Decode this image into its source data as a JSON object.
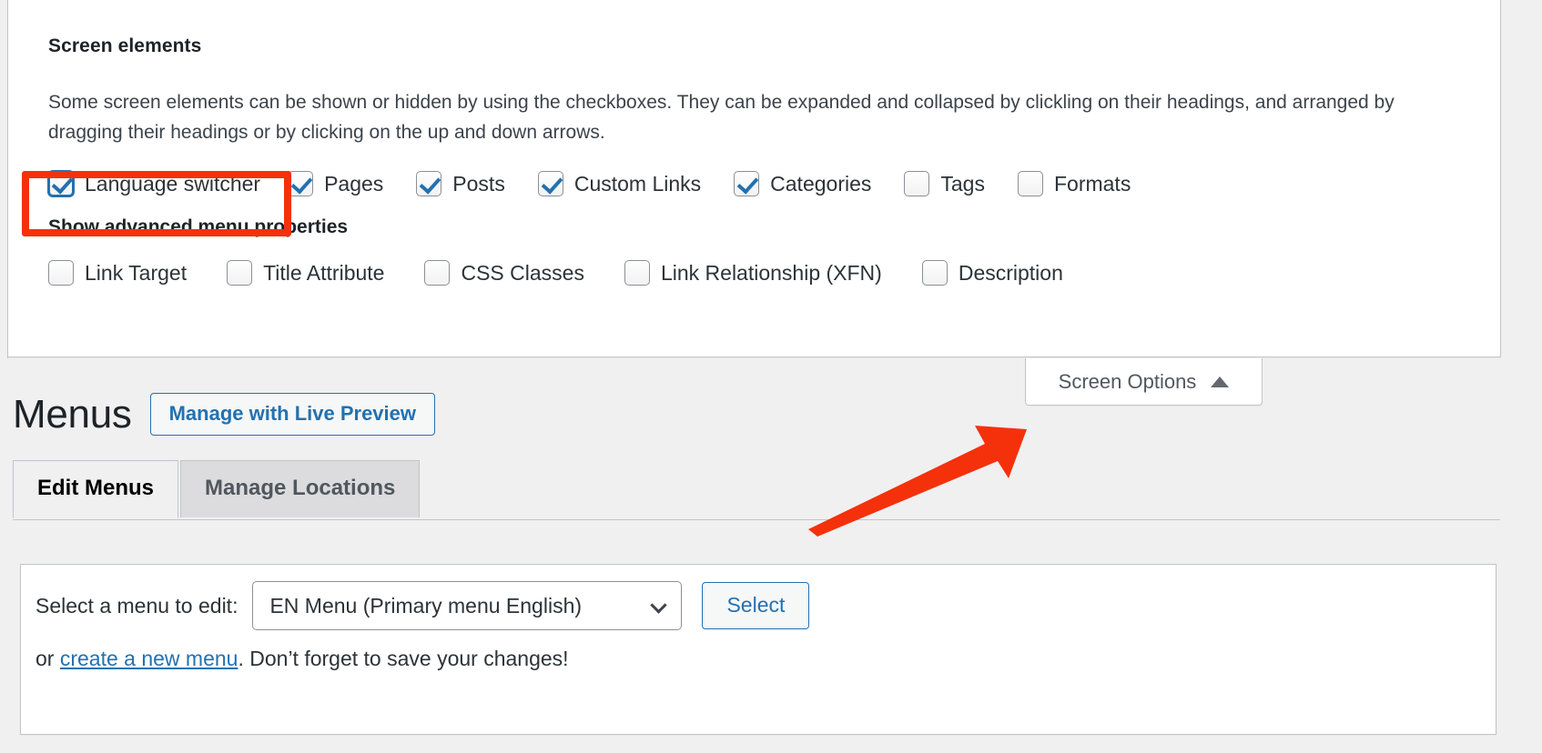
{
  "screen_options_panel": {
    "heading": "Screen elements",
    "description": "Some screen elements can be shown or hidden by using the checkboxes. They can be expanded and collapsed by clickling on their headings, and arranged by dragging their headings or by clicking on the up and down arrows.",
    "elements": [
      {
        "label": "Language switcher",
        "checked": true,
        "focused": true,
        "highlighted": true
      },
      {
        "label": "Pages",
        "checked": true,
        "focused": false,
        "highlighted": false
      },
      {
        "label": "Posts",
        "checked": true,
        "focused": false,
        "highlighted": false
      },
      {
        "label": "Custom Links",
        "checked": true,
        "focused": false,
        "highlighted": false
      },
      {
        "label": "Categories",
        "checked": true,
        "focused": false,
        "highlighted": false
      },
      {
        "label": "Tags",
        "checked": false,
        "focused": false,
        "highlighted": false
      },
      {
        "label": "Formats",
        "checked": false,
        "focused": false,
        "highlighted": false
      }
    ],
    "advanced_heading": "Show advanced menu properties",
    "advanced_properties": [
      {
        "label": "Link Target",
        "checked": false
      },
      {
        "label": "Title Attribute",
        "checked": false
      },
      {
        "label": "CSS Classes",
        "checked": false
      },
      {
        "label": "Link Relationship (XFN)",
        "checked": false
      },
      {
        "label": "Description",
        "checked": false
      }
    ]
  },
  "screen_options_tab": {
    "label": "Screen Options",
    "caret_icon": "triangle-up-icon",
    "expanded": true
  },
  "header": {
    "page_title": "Menus",
    "live_preview_button": "Manage with Live Preview"
  },
  "tabs": [
    {
      "label": "Edit Menus",
      "active": true
    },
    {
      "label": "Manage Locations",
      "active": false
    }
  ],
  "menu_editor": {
    "select_label": "Select a menu to edit:",
    "menu_select_value": "EN Menu (Primary menu English)",
    "select_caret_icon": "chevron-down-icon",
    "select_button": "Select",
    "helper_prefix": "or ",
    "helper_link": "create a new menu",
    "helper_suffix": ". Don’t forget to save your changes!"
  },
  "annotations": {
    "highlight_color": "#f4310b",
    "arrow_color": "#f4310b",
    "arrow_icon": "arrow-up-right-icon",
    "highlight_target": "Language switcher"
  },
  "colors": {
    "accent_blue": "#2271b1",
    "page_background": "#f0f0f1",
    "panel_background": "#ffffff",
    "border": "#c3c4c7",
    "text": "#2c3338"
  }
}
